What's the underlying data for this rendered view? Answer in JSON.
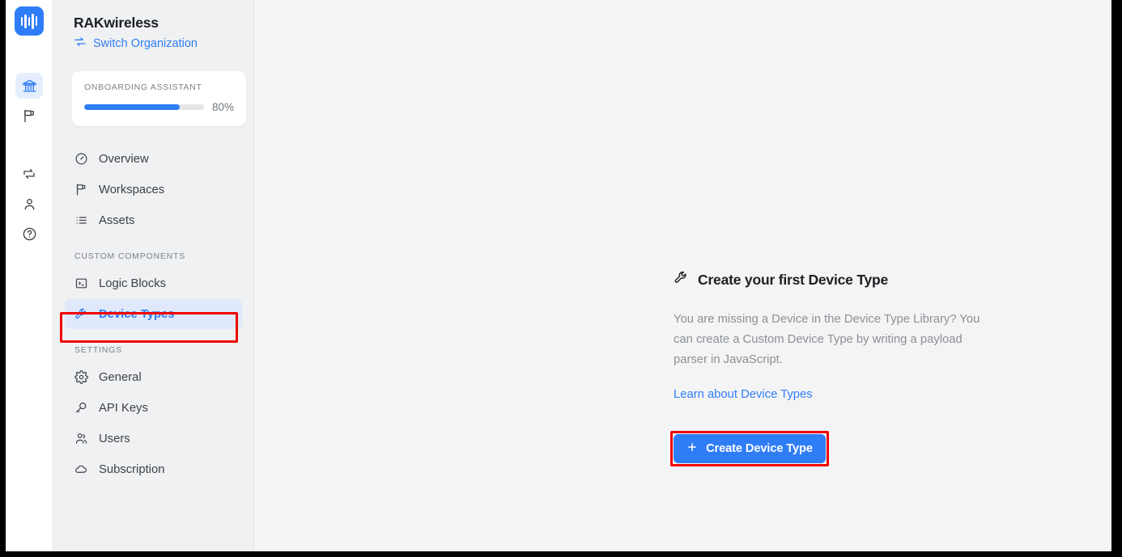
{
  "rail": {
    "logo": {
      "name": "rakwireless-logo",
      "bars": 5
    },
    "items": [
      {
        "icon": "bank-icon",
        "name": "organization",
        "active": true
      },
      {
        "icon": "flag-icon",
        "name": "workspaces",
        "active": false
      },
      {
        "icon": "swap-icon",
        "name": "transfer",
        "active": false
      },
      {
        "icon": "user-icon",
        "name": "account",
        "active": false
      },
      {
        "icon": "help-circle-icon",
        "name": "help",
        "active": false
      }
    ]
  },
  "sidebar": {
    "org_title": "RAKwireless",
    "switch_org_label": "Switch Organization",
    "switch_org_icon": "swap-arrows-icon",
    "onboarding": {
      "label": "ONBOARDING ASSISTANT",
      "percent_label": "80%",
      "percent_value": 80
    },
    "nav": [
      {
        "label": "Overview",
        "icon": "gauge-icon",
        "active": false
      },
      {
        "label": "Workspaces",
        "icon": "flag-icon",
        "active": false
      },
      {
        "label": "Assets",
        "icon": "list-icon",
        "active": false
      }
    ],
    "custom_components_label": "CUSTOM COMPONENTS",
    "custom_components": [
      {
        "label": "Logic Blocks",
        "icon": "terminal-icon",
        "active": false
      },
      {
        "label": "Device Types",
        "icon": "wrench-icon",
        "active": true
      }
    ],
    "settings_label": "SETTINGS",
    "settings": [
      {
        "label": "General",
        "icon": "gear-icon",
        "active": false
      },
      {
        "label": "API Keys",
        "icon": "key-icon",
        "active": false
      },
      {
        "label": "Users",
        "icon": "users-icon",
        "active": false
      },
      {
        "label": "Subscription",
        "icon": "cloud-icon",
        "active": false
      }
    ]
  },
  "main": {
    "heading": "Create your first Device Type",
    "heading_icon": "wrench-icon",
    "body": "You are missing a Device in the Device Type Library? You can create a Custom Device Type by writing a payload parser in JavaScript.",
    "link_label": "Learn about Device Types",
    "cta_label": "Create Device Type",
    "cta_icon": "plus-icon"
  },
  "annotations": [
    {
      "name": "device-types-highlight",
      "color": "#f00000"
    },
    {
      "name": "create-device-type-highlight",
      "color": "#f00000"
    }
  ],
  "colors": {
    "accent": "#2f7df6",
    "accent_soft": "#dfe9fb",
    "annotation": "#f00000",
    "sidebar_bg": "#f0f1f2",
    "content_bg": "#f4f4f5",
    "text": "#3d4146",
    "muted": "#8b9096"
  }
}
